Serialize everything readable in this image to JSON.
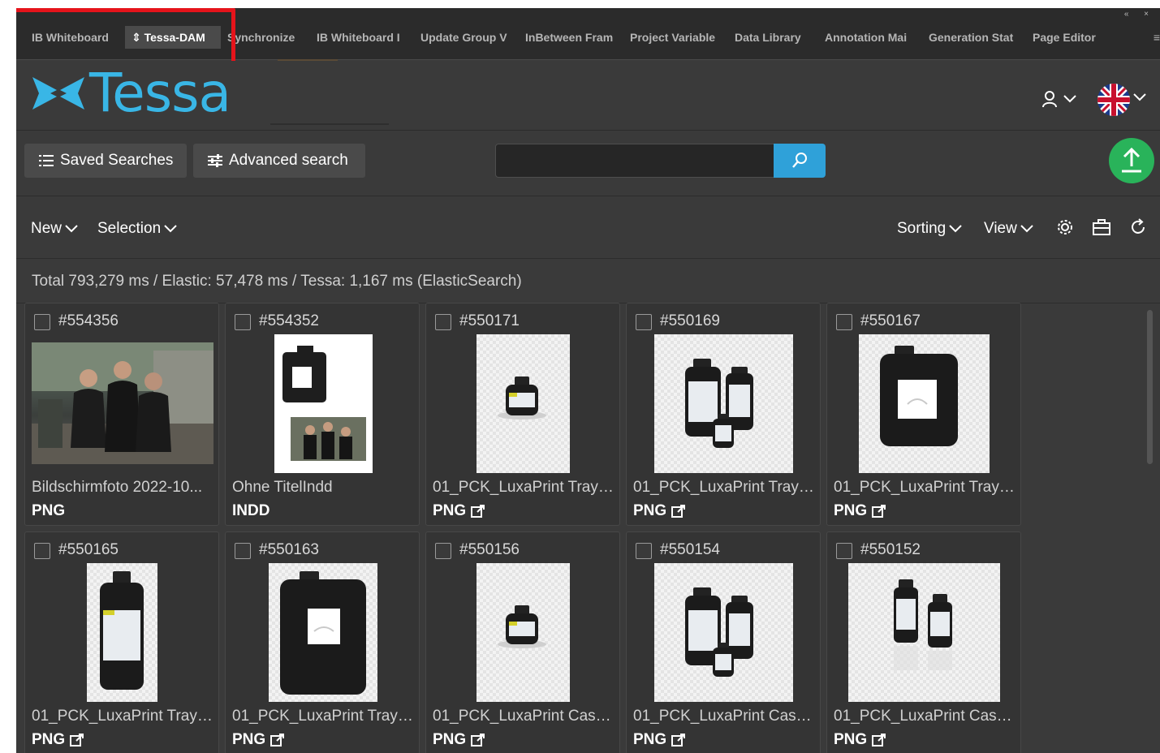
{
  "tabs": [
    {
      "label": "IB Whiteboard",
      "active": false
    },
    {
      "label": "⇕ Tessa-DAM",
      "active": true
    },
    {
      "label": "Synchronize",
      "active": false
    },
    {
      "label": "IB Whiteboard I",
      "active": false
    },
    {
      "label": "Update Group V",
      "active": false
    },
    {
      "label": "InBetween Fram",
      "active": false
    },
    {
      "label": "Project Variable",
      "active": false
    },
    {
      "label": "Data Library",
      "active": false
    },
    {
      "label": "Annotation Mai",
      "active": false
    },
    {
      "label": "Generation Stat",
      "active": false
    },
    {
      "label": "Page Editor",
      "active": false
    }
  ],
  "window_controls": "« ×",
  "tab_menu_icon": "≡",
  "header": {
    "logo_text": "Tessa",
    "user_icon": "user-icon",
    "language_icon": "uk-flag-icon"
  },
  "search": {
    "saved_searches_label": "Saved Searches",
    "advanced_search_label": "Advanced search",
    "query": "",
    "placeholder": ""
  },
  "toolbar": {
    "new_label": "New",
    "selection_label": "Selection",
    "sorting_label": "Sorting",
    "view_label": "View"
  },
  "stats_text": "Total 793,279 ms / Elastic: 57,478 ms / Tessa: 1,167 ms (ElasticSearch)",
  "assets": [
    {
      "id": "#554356",
      "title": "Bildschirmfoto 2022-10...",
      "type": "PNG",
      "link": false
    },
    {
      "id": "#554352",
      "title": "Ohne TitelIndd",
      "type": "INDD",
      "link": false
    },
    {
      "id": "#550171",
      "title": "01_PCK_LuxaPrint Tray ...",
      "type": "PNG",
      "link": true
    },
    {
      "id": "#550169",
      "title": "01_PCK_LuxaPrint Tray ...",
      "type": "PNG",
      "link": true
    },
    {
      "id": "#550167",
      "title": "01_PCK_LuxaPrint Tray_...",
      "type": "PNG",
      "link": true
    },
    {
      "id": "#550165",
      "title": "01_PCK_LuxaPrint Tray_...",
      "type": "PNG",
      "link": true
    },
    {
      "id": "#550163",
      "title": "01_PCK_LuxaPrint Tray_...",
      "type": "PNG",
      "link": true
    },
    {
      "id": "#550156",
      "title": "01_PCK_LuxaPrint Cast ...",
      "type": "PNG",
      "link": true
    },
    {
      "id": "#550154",
      "title": "01_PCK_LuxaPrint Cast ...",
      "type": "PNG",
      "link": true
    },
    {
      "id": "#550152",
      "title": "01_PCK_LuxaPrint Cast_...",
      "type": "PNG",
      "link": true
    }
  ],
  "colors": {
    "accent": "#2fa1d9",
    "logo": "#39b6e6",
    "upload": "#29b35a",
    "highlight": "#e5141b",
    "background": "#3a3a3a"
  }
}
